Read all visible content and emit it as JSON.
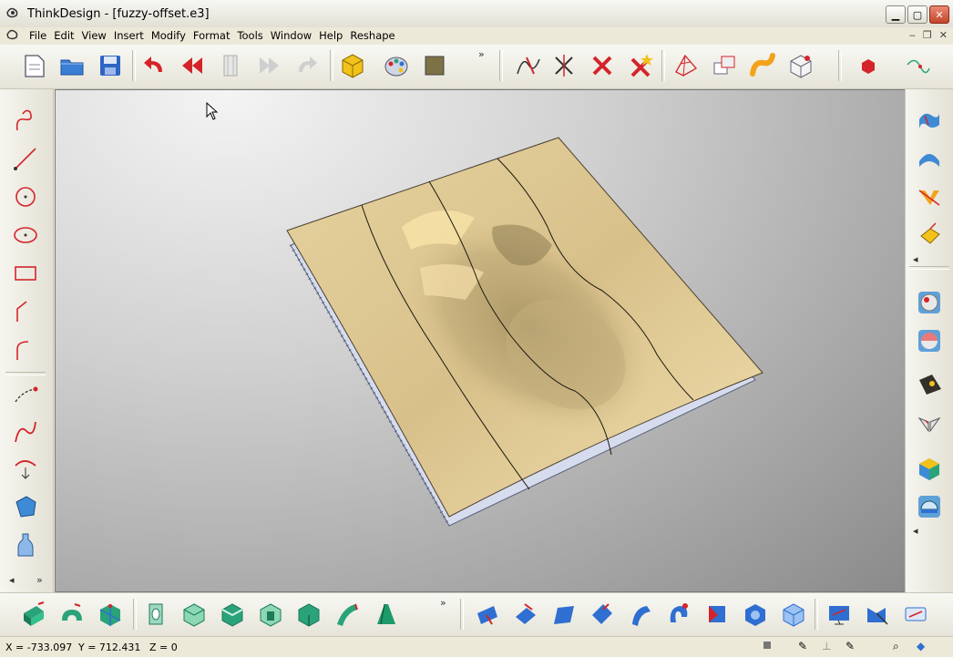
{
  "window": {
    "app": "ThinkDesign",
    "title": "ThinkDesign - [fuzzy-offset.e3]"
  },
  "menus": [
    "File",
    "Edit",
    "View",
    "Insert",
    "Modify",
    "Format",
    "Tools",
    "Window",
    "Help",
    "Reshape"
  ],
  "toolbar": {
    "overflow_glyph": "»"
  },
  "status": {
    "x": "X = -733.097",
    "y": "Y = 712.431",
    "z": "Z = 0"
  },
  "colors": {
    "surface": "#d8c08a",
    "accent_red": "#d4242a",
    "accent_blue": "#2f6fd1",
    "accent_green": "#2aa37a"
  },
  "icons_top": [
    "new-document-icon",
    "open-folder-icon",
    "save-icon",
    "undo-icon",
    "rewind-icon",
    "frame-icon",
    "forward-icon",
    "redo-icon",
    "solid-cube-icon",
    "material-palette-icon",
    "color-swatch-icon",
    "trim-curve-icon",
    "cut-curve-icon",
    "delete-curve-icon",
    "delete-extend-icon",
    "mesh-surface-icon",
    "copy-surface-icon",
    "pipe-surface-icon",
    "box-view-icon",
    "point-marker-icon",
    "curve-tool-icon"
  ],
  "icons_left": [
    "freehand-curve-icon",
    "line-icon",
    "circle-icon",
    "ellipse-icon",
    "rectangle-icon",
    "fillet-corner-icon",
    "arc-corner-icon",
    "spline-points-icon",
    "spline-curve-icon",
    "curve-edit-icon",
    "polygon-icon",
    "bottle-shape-icon"
  ],
  "icons_right": [
    "surface-patch-icon",
    "surface-blend-icon",
    "surface-sweep-icon",
    "surface-extrude-icon",
    "sphere-solid-icon",
    "sphere-cut-icon",
    "shape-deform-icon",
    "mirror-shape-icon",
    "box-solid-icon",
    "sphere-dome-icon"
  ],
  "icons_bottom": [
    "extrude-solid-icon",
    "revolve-solid-icon",
    "boolean-solid-icon",
    "shell-solid-icon",
    "chamfer-solid-icon",
    "fillet-solid-icon",
    "pocket-solid-icon",
    "draft-solid-icon",
    "sweep-solid-icon",
    "loft-solid-icon",
    "face-offset-icon",
    "face-blend-icon",
    "face-plane-icon",
    "face-move-icon",
    "face-bend-icon",
    "face-rotate-icon",
    "face-fill-icon",
    "face-shell-icon",
    "face-cube-icon",
    "view-monitor-icon",
    "view-satellite-icon",
    "view-drive-icon"
  ]
}
